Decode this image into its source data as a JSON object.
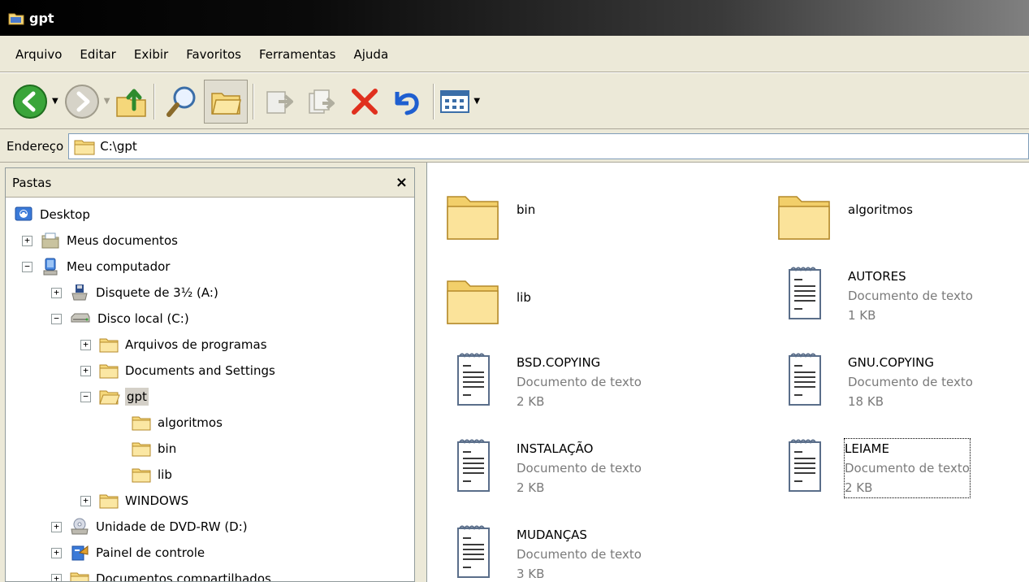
{
  "window": {
    "title": "gpt"
  },
  "menu": {
    "items": [
      "Arquivo",
      "Editar",
      "Exibir",
      "Favoritos",
      "Ferramentas",
      "Ajuda"
    ]
  },
  "toolbar": {
    "buttons": [
      "back-icon",
      "forward-icon",
      "up-folder-icon",
      "search-icon",
      "folders-icon",
      "move-to-icon",
      "copy-to-icon",
      "delete-icon",
      "undo-icon",
      "views-icon"
    ]
  },
  "address": {
    "label": "Endereço",
    "value": "C:\\gpt"
  },
  "folders_pane": {
    "title": "Pastas",
    "close": "×",
    "tree": [
      {
        "label": "Desktop"
      },
      {
        "label": "Meus documentos",
        "expander": "+"
      },
      {
        "label": "Meu computador",
        "expander": "−"
      },
      {
        "label": "Disquete de 3½ (A:)",
        "expander": "+"
      },
      {
        "label": "Disco local (C:)",
        "expander": "−"
      },
      {
        "label": "Arquivos de programas",
        "expander": "+"
      },
      {
        "label": "Documents and Settings",
        "expander": "+"
      },
      {
        "label": "gpt",
        "expander": "−"
      },
      {
        "label": "algoritmos"
      },
      {
        "label": "bin"
      },
      {
        "label": "lib"
      },
      {
        "label": "WINDOWS",
        "expander": "+"
      },
      {
        "label": "Unidade de DVD-RW (D:)",
        "expander": "+"
      },
      {
        "label": "Painel de controle",
        "expander": "+"
      },
      {
        "label": "Documentos compartilhados",
        "expander": "+"
      }
    ]
  },
  "files": [
    {
      "name": "bin",
      "kind": "folder"
    },
    {
      "name": "algoritmos",
      "kind": "folder"
    },
    {
      "name": "lib",
      "kind": "folder"
    },
    {
      "name": "AUTORES",
      "type": "Documento de texto",
      "size": "1 KB",
      "kind": "text"
    },
    {
      "name": "BSD.COPYING",
      "type": "Documento de texto",
      "size": "2 KB",
      "kind": "text"
    },
    {
      "name": "GNU.COPYING",
      "type": "Documento de texto",
      "size": "18 KB",
      "kind": "text"
    },
    {
      "name": "INSTALAÇÃO",
      "type": "Documento de texto",
      "size": "2 KB",
      "kind": "text"
    },
    {
      "name": "LEIAME",
      "type": "Documento de texto",
      "size": "2 KB",
      "kind": "text"
    },
    {
      "name": "MUDANÇAS",
      "type": "Documento de texto",
      "size": "3 KB",
      "kind": "text"
    }
  ]
}
